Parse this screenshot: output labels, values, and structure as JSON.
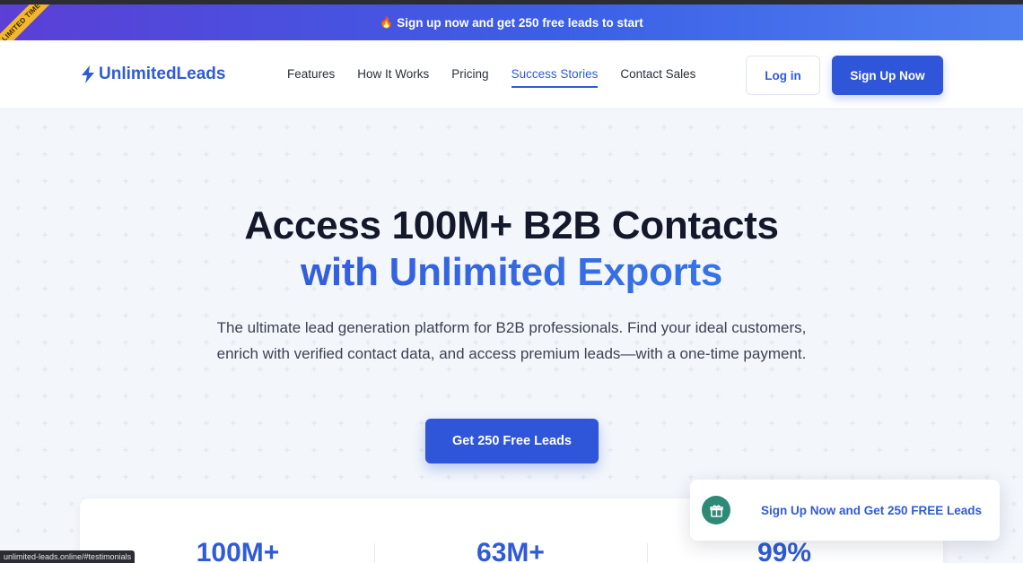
{
  "announcement": {
    "icon": "fire-icon",
    "text": "Sign up now and get 250 free leads to start",
    "ribbon": "LIMITED TIME"
  },
  "nav": {
    "logo_text": "UnlimitedLeads",
    "logo_icon": "lightning-bolt-icon",
    "items": [
      {
        "label": "Features"
      },
      {
        "label": "How It Works"
      },
      {
        "label": "Pricing"
      },
      {
        "label": "Success Stories"
      },
      {
        "label": "Contact Sales"
      }
    ],
    "active_item": "Success Stories",
    "login_label": "Log in",
    "signup_label": "Sign Up Now"
  },
  "hero": {
    "title_line1": "Access 100M+ B2B Contacts",
    "title_line2": "with Unlimited Exports",
    "subtitle": "The ultimate lead generation platform for B2B professionals. Find your ideal customers, enrich with verified contact data, and access premium leads—with a one-time payment.",
    "cta_label": "Get 250 Free Leads"
  },
  "stats": [
    {
      "value": "100M+"
    },
    {
      "value": "63M+"
    },
    {
      "value": "99%"
    }
  ],
  "toast": {
    "icon": "gift-icon",
    "text": "Sign Up Now and Get 250 FREE Leads"
  },
  "status_bar": {
    "url": "unlimited-leads.online/#testimonials"
  },
  "colors": {
    "brand": "#2f5bd8",
    "announcement_start": "#5b3fd6",
    "ribbon": "#f4b62a",
    "gift": "#2e8a76"
  }
}
